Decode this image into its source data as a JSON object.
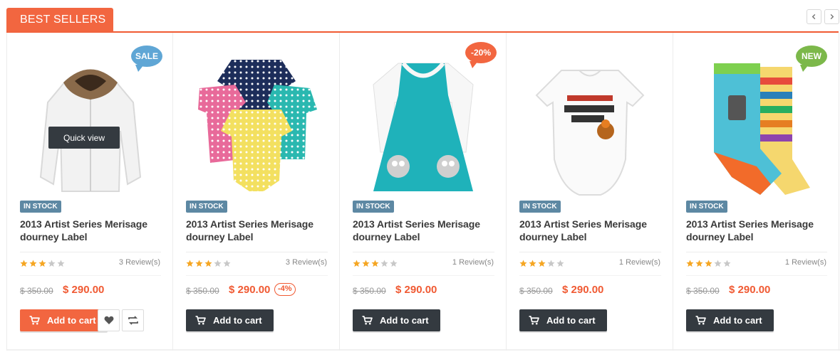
{
  "section": {
    "title": "BEST SELLERS",
    "accent_color": "#f26640",
    "nav": {
      "prev_icon": "chevron-left-icon",
      "next_icon": "chevron-right-icon"
    }
  },
  "products": [
    {
      "image": "white-jacket",
      "badge": "SALE",
      "badge_type": "sale",
      "quick_view": "Quick view",
      "stock": "IN STOCK",
      "title": "2013 Artist Series Merisage dourney Label",
      "rating": 3,
      "reviews": "3 Review(s)",
      "old_price": "$ 350.00",
      "price": "$ 290.00",
      "discount": "",
      "cart_label": "Add to cart",
      "cart_style": "orange",
      "show_actions": true
    },
    {
      "image": "polka-dot-bodysuits",
      "badge": "",
      "badge_type": "",
      "quick_view": "",
      "stock": "IN STOCK",
      "title": "2013 Artist Series Merisage dourney Label",
      "rating": 3,
      "reviews": "3 Review(s)",
      "old_price": "$ 350.00",
      "price": "$ 290.00",
      "discount": "-4%",
      "cart_label": "Add to cart",
      "cart_style": "dark",
      "show_actions": false
    },
    {
      "image": "teal-owl-dress",
      "badge": "-20%",
      "badge_type": "off",
      "quick_view": "",
      "stock": "IN STOCK",
      "title": "2013 Artist Series Merisage dourney Label",
      "rating": 3,
      "reviews": "1 Review(s)",
      "old_price": "$ 350.00",
      "price": "$ 290.00",
      "discount": "",
      "cart_label": "Add to cart",
      "cart_style": "dark",
      "show_actions": false
    },
    {
      "image": "turkey-day-onesie",
      "badge": "",
      "badge_type": "",
      "quick_view": "",
      "stock": "IN STOCK",
      "title": "2013 Artist Series Merisage dourney Label",
      "rating": 3,
      "reviews": "1 Review(s)",
      "old_price": "$ 350.00",
      "price": "$ 290.00",
      "discount": "",
      "cart_label": "Add to cart",
      "cart_style": "dark",
      "show_actions": false
    },
    {
      "image": "striped-socks",
      "badge": "NEW",
      "badge_type": "new",
      "quick_view": "",
      "stock": "IN STOCK",
      "title": "2013 Artist Series Merisage dourney Label",
      "rating": 3,
      "reviews": "1 Review(s)",
      "old_price": "$ 350.00",
      "price": "$ 290.00",
      "discount": "",
      "cart_label": "Add to cart",
      "cart_style": "dark",
      "show_actions": false
    }
  ],
  "colors": {
    "star_on": "#f5a623",
    "star_off": "#c8c8c8",
    "price": "#f05a33",
    "stock_badge": "#5d88a3"
  },
  "icons": {
    "cart": "shopping-cart-icon",
    "wishlist": "heart-icon",
    "compare": "compare-arrows-icon"
  }
}
